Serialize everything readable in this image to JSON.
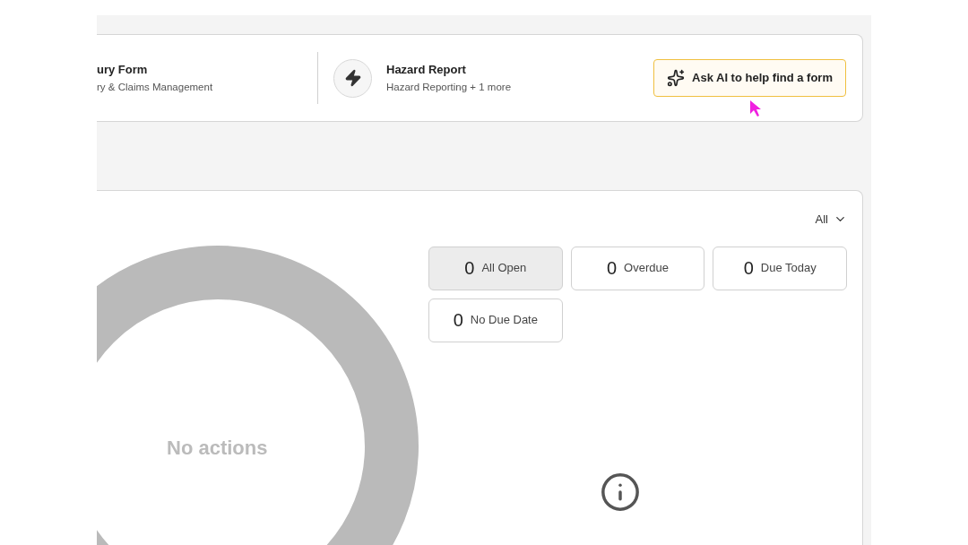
{
  "forms": [
    {
      "title": "ury Form",
      "subtitle": "ry & Claims Management",
      "kind": "plain"
    },
    {
      "title": "Hazard Report",
      "subtitle": "Hazard Reporting + 1 more",
      "kind": "bolt"
    }
  ],
  "ai_button": {
    "label": "Ask AI to help find a form"
  },
  "actions": {
    "filter": "All",
    "center_label": "No actions",
    "counters": [
      {
        "count": "0",
        "label": "All Open",
        "selected": true
      },
      {
        "count": "0",
        "label": "Overdue",
        "selected": false
      },
      {
        "count": "0",
        "label": "Due Today",
        "selected": false
      },
      {
        "count": "0",
        "label": "No Due Date",
        "selected": false
      }
    ]
  }
}
